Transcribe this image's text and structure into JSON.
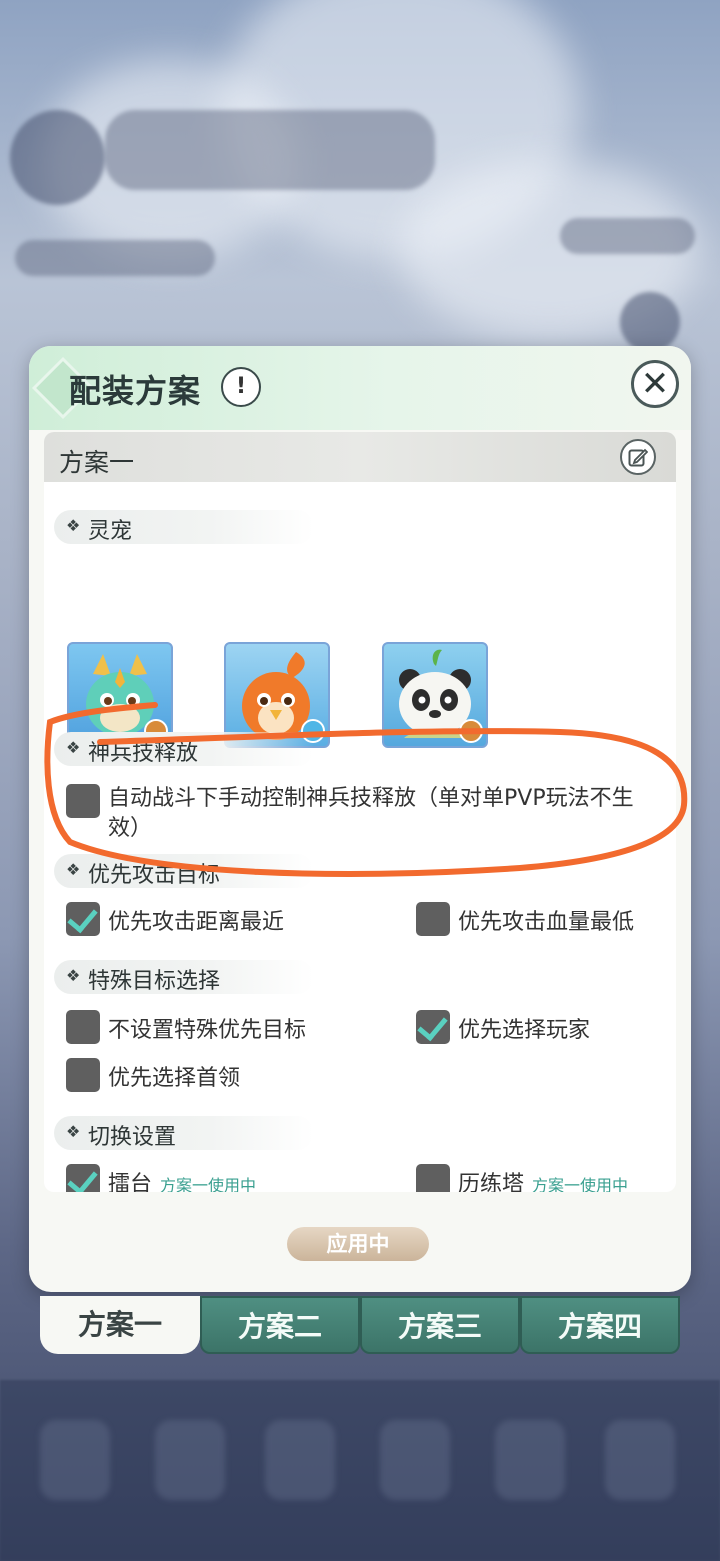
{
  "dialog": {
    "title": "配装方案",
    "info_label": "!",
    "close_label": "✕",
    "panel_title": "方案一",
    "sections": {
      "pets": "灵宠",
      "weapon": "神兵技释放",
      "priority": "优先攻击目标",
      "special": "特殊目标选择",
      "switch": "切换设置"
    },
    "options": {
      "manual_weapon": "自动战斗下手动控制神兵技释放（单对单PVP玩法不生效）",
      "nearest": "优先攻击距离最近",
      "lowest_hp": "优先攻击血量最低",
      "no_special": "不设置特殊优先目标",
      "prefer_player": "优先选择玩家",
      "prefer_leader": "优先选择首领",
      "arena": "擂台",
      "arena_status": "方案一使用中",
      "trial_tower": "历练塔",
      "trial_status": "方案一使用中"
    },
    "apply_label": "应用中"
  },
  "tabs": [
    "方案一",
    "方案二",
    "方案三",
    "方案四"
  ],
  "colors": {
    "accent": "#5ad1c0",
    "tab_active_bg": "#f7f8f4",
    "tab_inactive_bg": "#3c7468",
    "annotation": "#f26a2e"
  }
}
